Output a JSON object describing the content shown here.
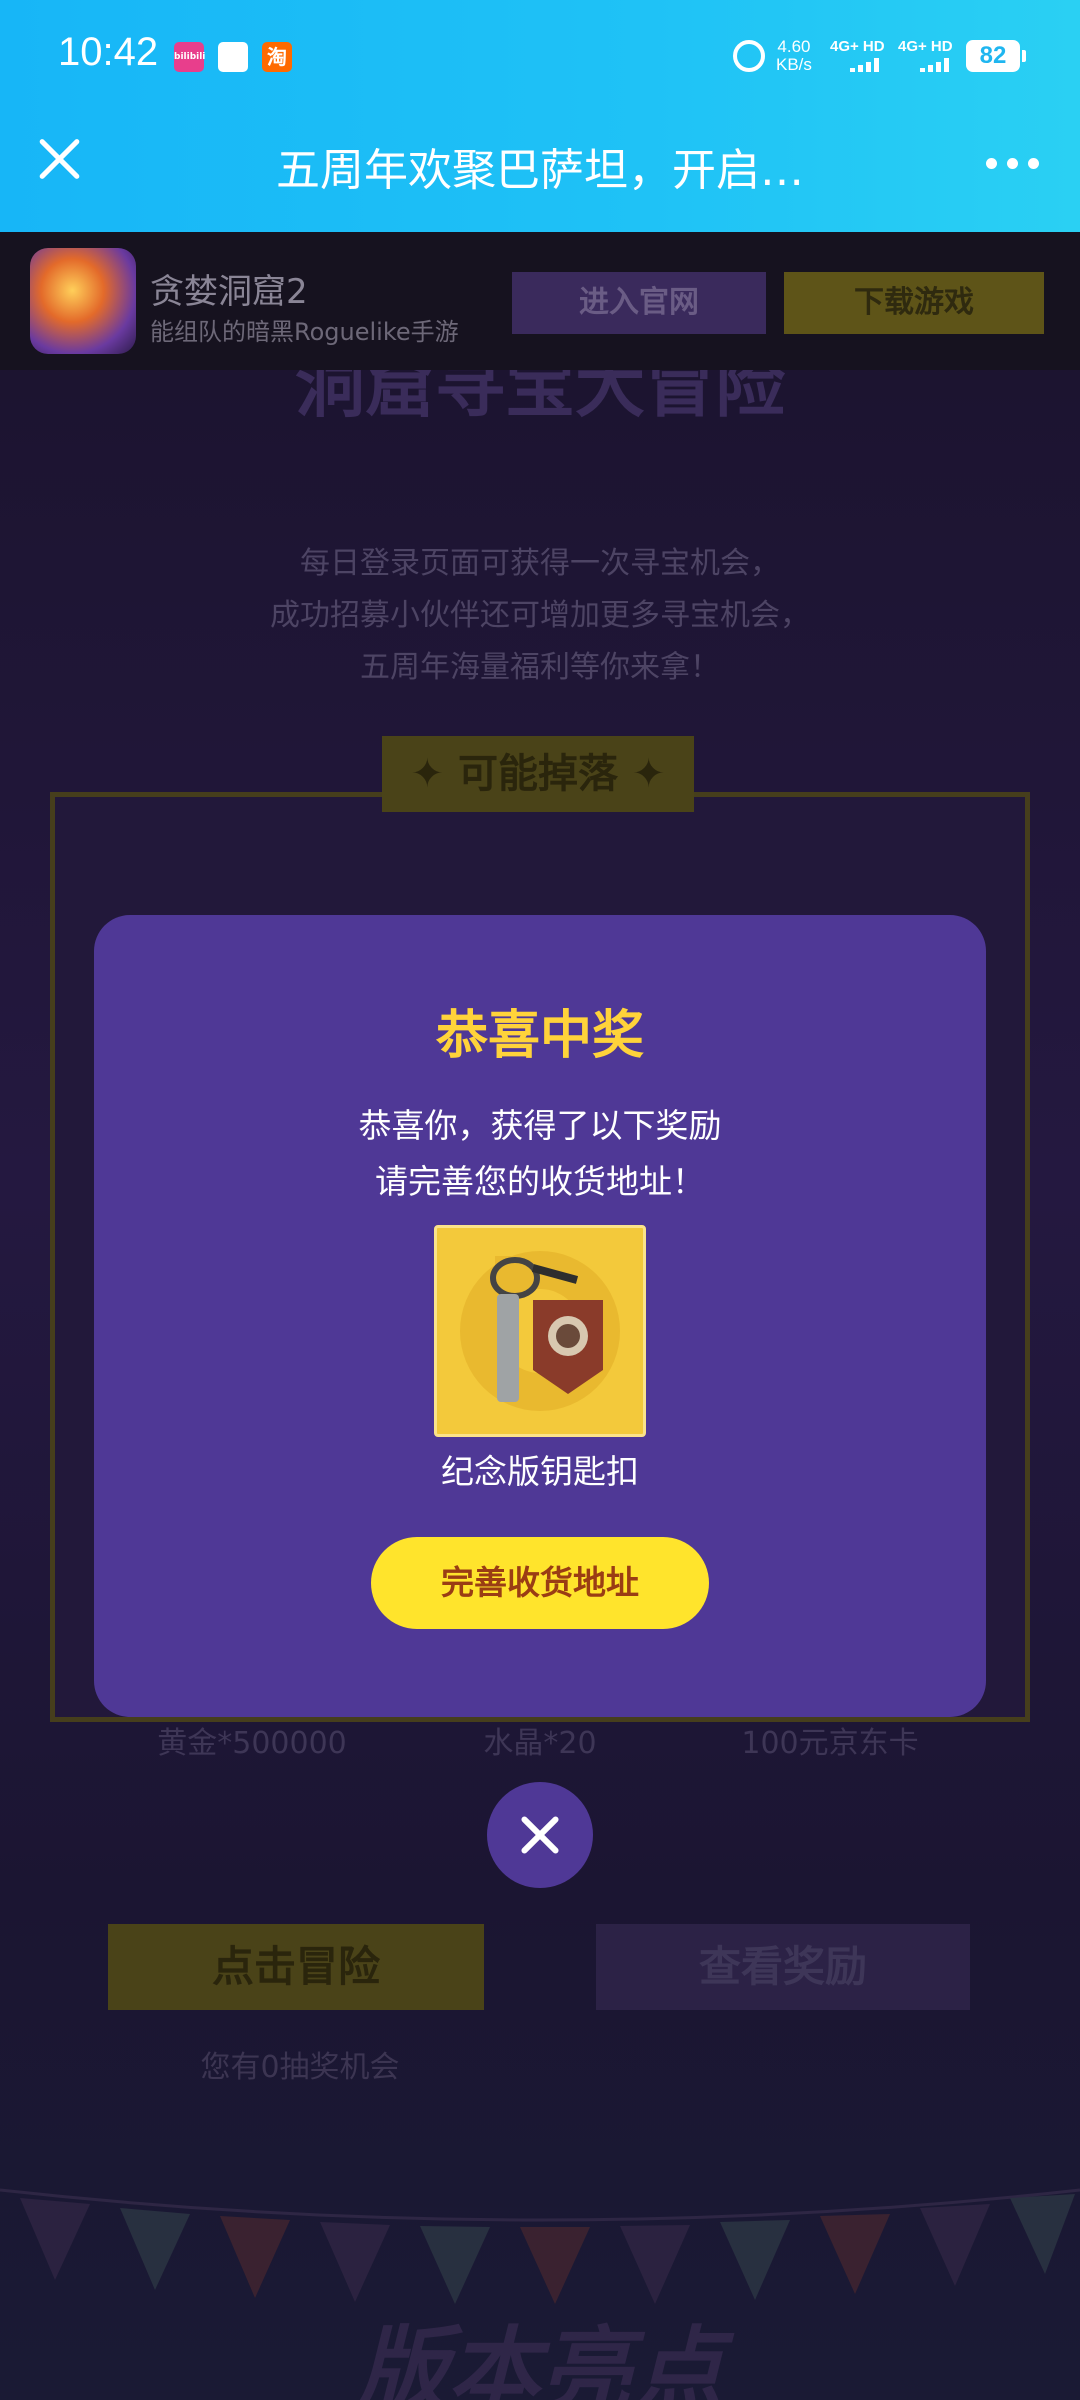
{
  "status_bar": {
    "time": "10:42",
    "speed": "4.60",
    "speed_unit": "KB/s",
    "signal1": "4G+ HD",
    "signal2": "4G+ HD",
    "battery": "82",
    "app_icon_a": "bilibili",
    "app_icon_c": "淘"
  },
  "title_bar": {
    "title": "五周年欢聚巴萨坦，开启…"
  },
  "game_banner": {
    "name": "贪婪洞窟2",
    "subtitle": "能组队的暗黑Roguelike手游",
    "site_button": "进入官网",
    "download_button": "下载游戏"
  },
  "background_page": {
    "heading": "洞窟寻宝大冒险",
    "intro": [
      "每日登录页面可获得一次寻宝机会，",
      "成功招募小伙伴还可增加更多寻宝机会，",
      "五周年海量福利等你来拿！"
    ],
    "drop_label": "✦ 可能掉落 ✦",
    "prizes": [
      "黄金*500000",
      "水晶*20",
      "100元京东卡"
    ],
    "adventure_button": "点击冒险",
    "view_rewards_button": "查看奖励",
    "chances_text": "您有0抽奖机会",
    "bottom_title": "版本亮点"
  },
  "modal": {
    "title": "恭喜中奖",
    "line1": "恭喜你，获得了以下奖励",
    "line2": "请完善您的收货地址！",
    "prize_name": "纪念版钥匙扣",
    "address_button": "完善收货地址"
  },
  "colors": {
    "status_gradient_start": "#17b6f7",
    "modal_bg": "#4f3896",
    "modal_title": "#ffd33a",
    "address_button": "#ffe42c"
  }
}
